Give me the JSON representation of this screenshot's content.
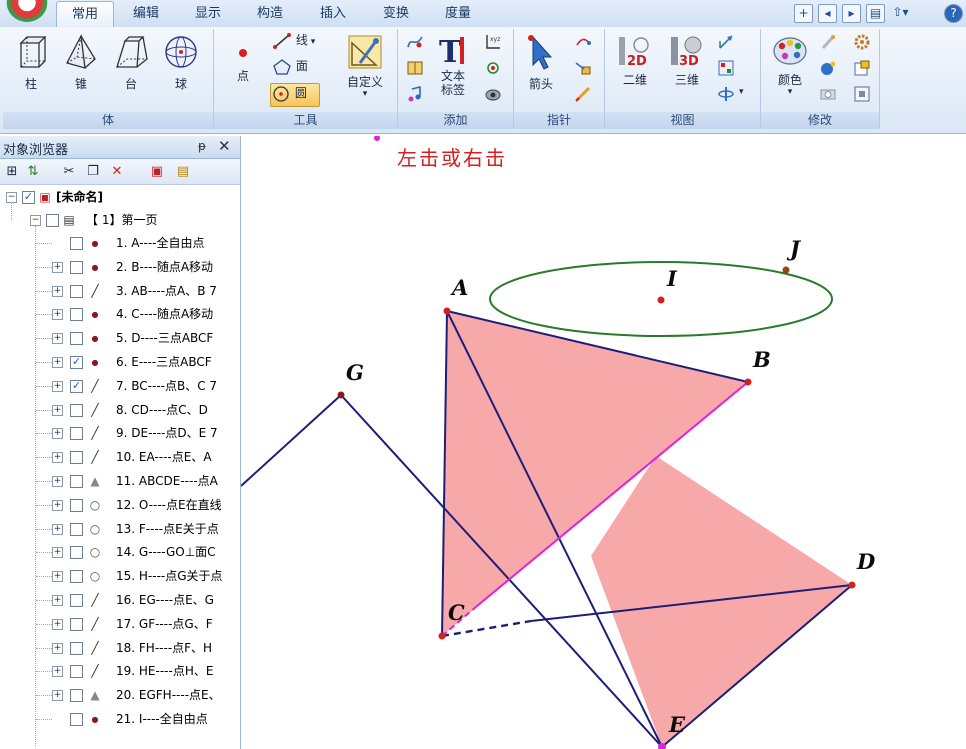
{
  "tabs": [
    {
      "label": "常用",
      "active": true
    },
    {
      "label": "编辑",
      "active": false
    },
    {
      "label": "显示",
      "active": false
    },
    {
      "label": "构造",
      "active": false
    },
    {
      "label": "插入",
      "active": false
    },
    {
      "label": "变换",
      "active": false
    },
    {
      "label": "度量",
      "active": false
    }
  ],
  "ribbon": {
    "groups": {
      "solid": "体",
      "tools": "工具",
      "add": "添加",
      "pointer": "指针",
      "view": "视图",
      "modify": "修改"
    },
    "buttons": {
      "prism": "柱",
      "pyramid": "锥",
      "frustum": "台",
      "sphere": "球",
      "point": "点",
      "line": "线",
      "face": "面",
      "circle": "圆",
      "custom": "自定义",
      "text_line1": "文本",
      "text_line2": "标签",
      "arrow": "箭头",
      "view2d": "二维",
      "view3d": "三维",
      "color": "颜色",
      "icon_2d": "2D",
      "icon_3d": "3D"
    }
  },
  "panel": {
    "title": "对象浏览器",
    "pin_glyph": "ᵽ",
    "close_glyph": "✕",
    "root": "[未命名]",
    "page": "【 1】第一页",
    "items": [
      {
        "label": "1. A----全自由点",
        "checked": false,
        "type": "point",
        "expandable": false
      },
      {
        "label": "2. B----随点A移动",
        "checked": false,
        "type": "point",
        "expandable": true
      },
      {
        "label": "3. AB----点A、B 7",
        "checked": false,
        "type": "line",
        "expandable": true
      },
      {
        "label": "4. C----随点A移动",
        "checked": false,
        "type": "point",
        "expandable": true
      },
      {
        "label": "5. D----三点ABCF",
        "checked": false,
        "type": "point",
        "expandable": true
      },
      {
        "label": "6. E----三点ABCF",
        "checked": true,
        "type": "point",
        "expandable": true
      },
      {
        "label": "7. BC----点B、C 7",
        "checked": true,
        "type": "line",
        "expandable": true
      },
      {
        "label": "8. CD----点C、D",
        "checked": false,
        "type": "line",
        "expandable": true
      },
      {
        "label": "9. DE----点D、E 7",
        "checked": false,
        "type": "line",
        "expandable": true
      },
      {
        "label": "10. EA----点E、A",
        "checked": false,
        "type": "line",
        "expandable": true
      },
      {
        "label": "11. ABCDE----点A",
        "checked": false,
        "type": "polygon",
        "expandable": true
      },
      {
        "label": "12. O----点E在直线",
        "checked": false,
        "type": "hollow",
        "expandable": true
      },
      {
        "label": "13. F----点E关于点",
        "checked": false,
        "type": "hollow",
        "expandable": true
      },
      {
        "label": "14. G----GO⊥面C",
        "checked": false,
        "type": "hollow",
        "expandable": true
      },
      {
        "label": "15. H----点G关于点",
        "checked": false,
        "type": "hollow",
        "expandable": true
      },
      {
        "label": "16. EG----点E、G",
        "checked": false,
        "type": "line",
        "expandable": true
      },
      {
        "label": "17. GF----点G、F",
        "checked": false,
        "type": "line",
        "expandable": true
      },
      {
        "label": "18. FH----点F、H",
        "checked": false,
        "type": "line",
        "expandable": true
      },
      {
        "label": "19. HE----点H、E",
        "checked": false,
        "type": "line",
        "expandable": true
      },
      {
        "label": "20. EGFH----点E、",
        "checked": false,
        "type": "polygon",
        "expandable": true
      },
      {
        "label": "21. I----全自由点",
        "checked": false,
        "type": "point",
        "expandable": false
      }
    ]
  },
  "canvas": {
    "hint": "左击或右击",
    "points": [
      "A",
      "B",
      "C",
      "D",
      "E",
      "G",
      "I",
      "J"
    ]
  },
  "colors": {
    "accent_red": "#d42020",
    "fill_pink": "#f7a8a8",
    "line_navy": "#1c1f7a",
    "magenta": "#e020e0",
    "circle_green": "#2a7a2a"
  }
}
